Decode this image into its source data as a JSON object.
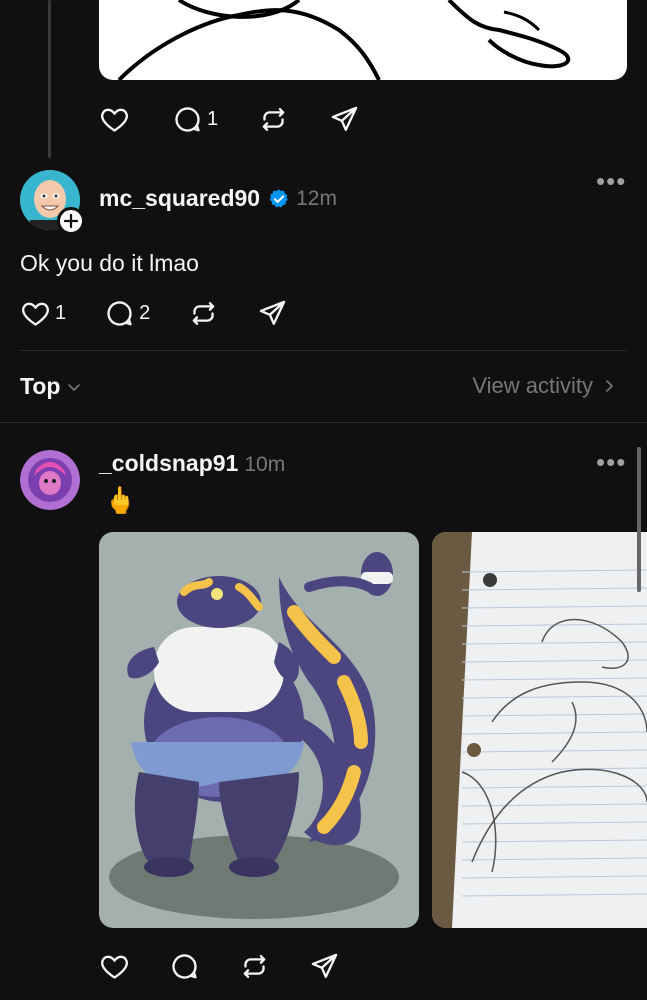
{
  "post1": {
    "actions": {
      "like_count": "",
      "reply_count": "1",
      "repost_count": "",
      "share_count": ""
    }
  },
  "post2": {
    "username": "mc_squared90",
    "time": "12m",
    "text": "Ok you do it lmao",
    "actions": {
      "like_count": "1",
      "reply_count": "2"
    }
  },
  "sort": {
    "label": "Top",
    "view_activity": "View activity"
  },
  "post3": {
    "username": "_coldsnap91",
    "time": "10m",
    "text": "🖕"
  },
  "colors": {
    "background": "#101010",
    "text": "#f3f5f7",
    "muted": "#777777",
    "verified": "#0095f6"
  }
}
